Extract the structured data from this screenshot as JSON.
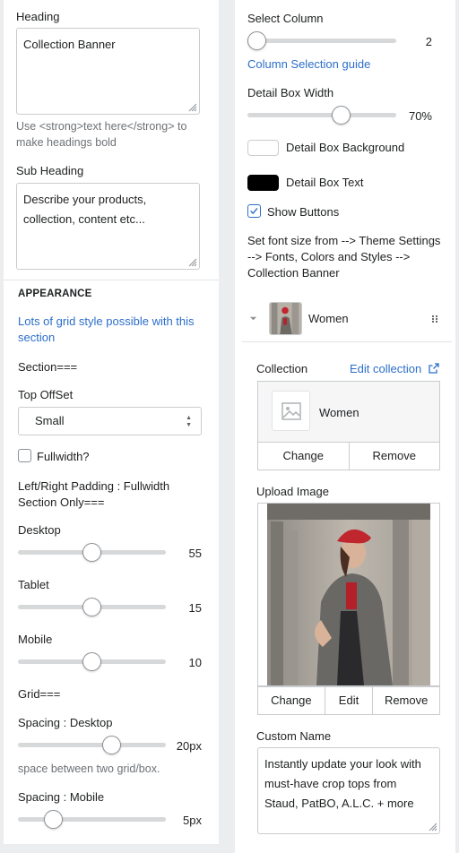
{
  "left": {
    "heading": {
      "label": "Heading",
      "value": "Collection Banner"
    },
    "heading_help": "Use <strong>text here</strong> to make headings bold",
    "sub_heading": {
      "label": "Sub Heading",
      "value": "Describe your products, collection, content etc..."
    },
    "appearance_title": "APPEARANCE",
    "grid_link": "Lots of grid style possible with this section",
    "section_label": "Section===",
    "top_offset": {
      "label": "Top OffSet",
      "selected": "Small"
    },
    "fullwidth": {
      "label": "Fullwidth?",
      "checked": false
    },
    "padding_label": "Left/Right Padding : Fullwidth Section Only===",
    "desktop": {
      "label": "Desktop",
      "value": "55",
      "fraction": 0.5
    },
    "tablet": {
      "label": "Tablet",
      "value": "15",
      "fraction": 0.5
    },
    "mobile": {
      "label": "Mobile",
      "value": "10",
      "fraction": 0.5
    },
    "grid_label": "Grid===",
    "spacing_desktop": {
      "label": "Spacing : Desktop",
      "value": "20px",
      "fraction": 0.65,
      "help": "space between two grid/box."
    },
    "spacing_mobile": {
      "label": "Spacing : Mobile",
      "value": "5px",
      "fraction": 0.2
    }
  },
  "right": {
    "select_column": {
      "label": "Select Column",
      "value": "2",
      "fraction": 0.0
    },
    "column_guide_link": "Column Selection guide",
    "detail_box_width": {
      "label": "Detail Box Width",
      "value": "70%",
      "fraction": 0.65
    },
    "detail_box_background": {
      "label": "Detail Box Background",
      "color": "#ffffff"
    },
    "detail_box_text": {
      "label": "Detail Box Text",
      "color": "#000000"
    },
    "show_buttons": {
      "label": "Show Buttons",
      "checked": true
    },
    "font_note": "Set font size from --> Theme Settings --> Fonts, Colors and Styles --> Collection Banner",
    "block": {
      "title": "Women",
      "collection_label": "Collection",
      "edit_collection_link": "Edit collection",
      "collection_name": "Women",
      "change_label": "Change",
      "remove_label": "Remove",
      "upload_image_label": "Upload Image",
      "image_change": "Change",
      "image_edit": "Edit",
      "image_remove": "Remove",
      "custom_name_label": "Custom Name",
      "custom_name_value": "Instantly update your look with must-have crop tops from Staud, PatBO, A.L.C. + more"
    }
  },
  "colors": {
    "accent": "#2c6ecb",
    "border": "#c9cccf",
    "panel_bg": "#ffffff",
    "page_bg": "#ebedef"
  },
  "icons": [
    "resize-grip-icon",
    "chevron-updown-icon",
    "checkmark-icon",
    "caret-down-icon",
    "drag-handle-icon",
    "external-link-icon",
    "image-placeholder-icon"
  ]
}
